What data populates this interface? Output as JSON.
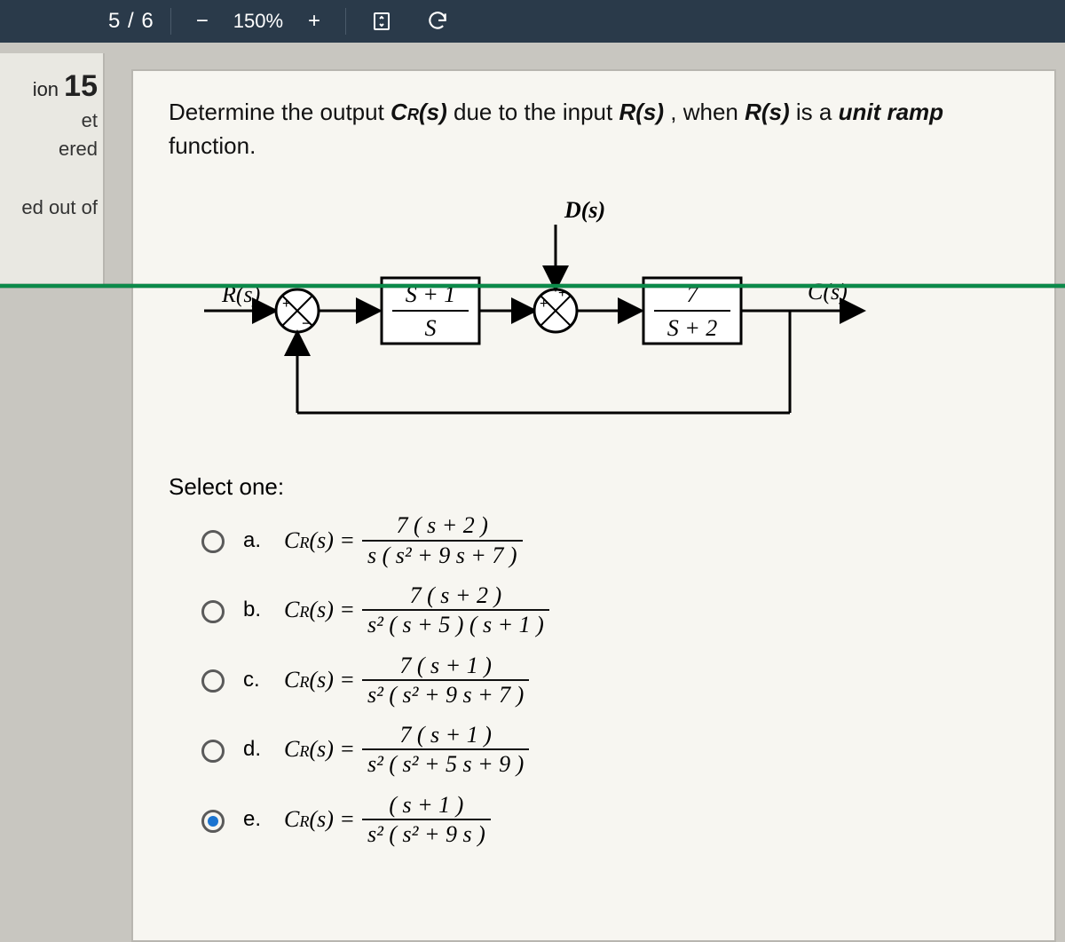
{
  "toolbar": {
    "page_current": "5",
    "page_total": "6",
    "zoom_minus": "−",
    "zoom_value": "150%",
    "zoom_plus": "+"
  },
  "sidebar": {
    "question_prefix": "ion",
    "question_number": "15",
    "line1": "et",
    "line2": "ered",
    "line3": "ed out of"
  },
  "prompt": {
    "text1": "Determine the output ",
    "cr": "C",
    "r_sub": "R",
    "s_arg": "(s)",
    "text2": " due to the input ",
    "r_s": "R(s)",
    "text3": ", when ",
    "r_s2": "R(s)",
    "text4": " is a ",
    "unit_ramp": "unit ramp",
    "text5": " function."
  },
  "diagram": {
    "input_label": "R(s)",
    "disturb_label": "D(s)",
    "output_label": "C(s)",
    "block1_num": "S + 1",
    "block1_den": "S",
    "block2_num": "7",
    "block2_den": "S + 2"
  },
  "select_label": "Select one:",
  "lhs": "C",
  "lhs_sub": "R",
  "lhs_arg": "(s) =",
  "options": [
    {
      "letter": "a.",
      "num": "7 ( s + 2 )",
      "den": "s ( s² + 9 s + 7 )",
      "checked": false
    },
    {
      "letter": "b.",
      "num": "7 ( s + 2 )",
      "den": "s² ( s + 5 ) ( s + 1 )",
      "checked": false
    },
    {
      "letter": "c.",
      "num": "7 ( s + 1 )",
      "den": "s² ( s² + 9 s + 7 )",
      "checked": false
    },
    {
      "letter": "d.",
      "num": "7 ( s + 1 )",
      "den": "s² ( s² + 5 s + 9 )",
      "checked": false
    },
    {
      "letter": "e.",
      "num": "( s + 1 )",
      "den": "s² ( s² + 9 s )",
      "checked": true
    }
  ]
}
